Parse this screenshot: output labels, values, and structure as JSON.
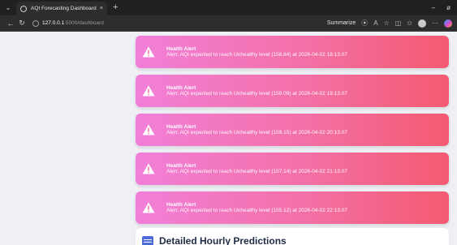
{
  "browser": {
    "tab_title": "AQI Forecasting Dashboard",
    "tab_close": "×",
    "new_tab": "+",
    "url_host": "127.0.0.1",
    "url_path": ":5000/dashboard",
    "summarize_label": "Summarize",
    "window_minimize": "–",
    "window_restore": "ø"
  },
  "alerts": [
    {
      "title": "Health Alert",
      "message": "Alert: AQI expected to reach Unhealthy level (158.84) at 2026-04-02 18:13:07"
    },
    {
      "title": "Health Alert",
      "message": "Alert: AQI expected to reach Unhealthy level (159.09) at 2026-04-02 19:13:07"
    },
    {
      "title": "Health Alert",
      "message": "Alert: AQI expected to reach Unhealthy level (159.15) at 2026-04-02 20:13:07"
    },
    {
      "title": "Health Alert",
      "message": "Alert: AQI expected to reach Unhealthy level (157.14) at 2026-04-02 21:13:07"
    },
    {
      "title": "Health Alert",
      "message": "Alert: AQI expected to reach Unhealthy level (155.12) at 2026-04-02 22:13:07"
    }
  ],
  "detail": {
    "title": "Detailed Hourly Predictions"
  },
  "colors": {
    "alert_gradient_start": "#f27fd9",
    "alert_gradient_end": "#f45a70",
    "page_background": "#eef0f6",
    "accent_blue": "#4f6bd8"
  }
}
